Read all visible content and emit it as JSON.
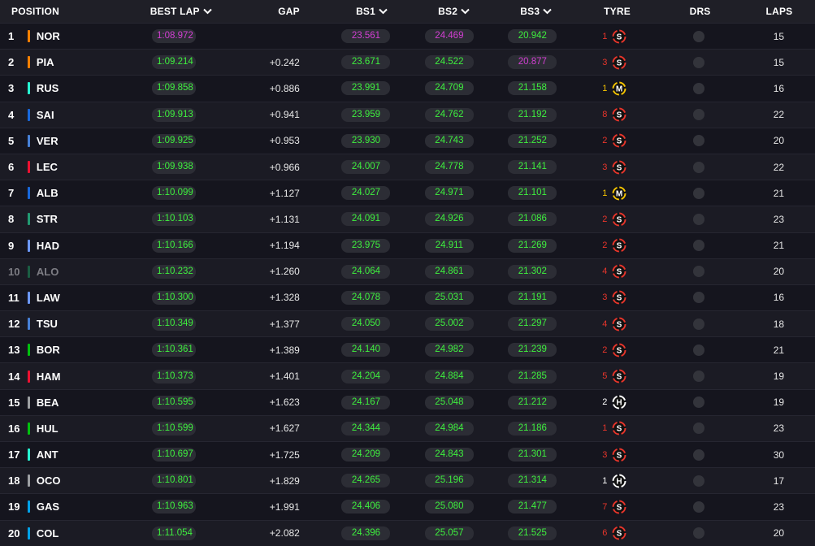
{
  "header": {
    "position": "POSITION",
    "best_lap": "BEST LAP",
    "gap": "GAP",
    "bs1": "BS1",
    "bs2": "BS2",
    "bs3": "BS3",
    "tyre": "TYRE",
    "drs": "DRS",
    "laps": "LAPS"
  },
  "colors": {
    "green": "#3ef03e",
    "purple": "#d33fd3",
    "soft": "#e8352b",
    "medium": "#f6c400",
    "hard": "#ffffff"
  },
  "rows": [
    {
      "pos": "1",
      "code": "NOR",
      "team_color": "#ff8000",
      "best": "1:08.972",
      "best_c": "purple",
      "gap": "",
      "bs1": "23.561",
      "bs1_c": "purple",
      "bs2": "24.469",
      "bs2_c": "purple",
      "bs3": "20.942",
      "bs3_c": "green",
      "tyre_age": "1",
      "compound": "S",
      "laps": "15",
      "dim": false
    },
    {
      "pos": "2",
      "code": "PIA",
      "team_color": "#ff8000",
      "best": "1:09.214",
      "best_c": "green",
      "gap": "+0.242",
      "bs1": "23.671",
      "bs1_c": "green",
      "bs2": "24.522",
      "bs2_c": "green",
      "bs3": "20.877",
      "bs3_c": "purple",
      "tyre_age": "3",
      "compound": "S",
      "laps": "15",
      "dim": false
    },
    {
      "pos": "3",
      "code": "RUS",
      "team_color": "#27f4d2",
      "best": "1:09.858",
      "best_c": "green",
      "gap": "+0.886",
      "bs1": "23.991",
      "bs1_c": "green",
      "bs2": "24.709",
      "bs2_c": "green",
      "bs3": "21.158",
      "bs3_c": "green",
      "tyre_age": "1",
      "compound": "M",
      "laps": "16",
      "dim": false
    },
    {
      "pos": "4",
      "code": "SAI",
      "team_color": "#1868db",
      "best": "1:09.913",
      "best_c": "green",
      "gap": "+0.941",
      "bs1": "23.959",
      "bs1_c": "green",
      "bs2": "24.762",
      "bs2_c": "green",
      "bs3": "21.192",
      "bs3_c": "green",
      "tyre_age": "8",
      "compound": "S",
      "laps": "22",
      "dim": false
    },
    {
      "pos": "5",
      "code": "VER",
      "team_color": "#4781d7",
      "best": "1:09.925",
      "best_c": "green",
      "gap": "+0.953",
      "bs1": "23.930",
      "bs1_c": "green",
      "bs2": "24.743",
      "bs2_c": "green",
      "bs3": "21.252",
      "bs3_c": "green",
      "tyre_age": "2",
      "compound": "S",
      "laps": "20",
      "dim": false
    },
    {
      "pos": "6",
      "code": "LEC",
      "team_color": "#ed1131",
      "best": "1:09.938",
      "best_c": "green",
      "gap": "+0.966",
      "bs1": "24.007",
      "bs1_c": "green",
      "bs2": "24.778",
      "bs2_c": "green",
      "bs3": "21.141",
      "bs3_c": "green",
      "tyre_age": "3",
      "compound": "S",
      "laps": "22",
      "dim": false
    },
    {
      "pos": "7",
      "code": "ALB",
      "team_color": "#1868db",
      "best": "1:10.099",
      "best_c": "green",
      "gap": "+1.127",
      "bs1": "24.027",
      "bs1_c": "green",
      "bs2": "24.971",
      "bs2_c": "green",
      "bs3": "21.101",
      "bs3_c": "green",
      "tyre_age": "1",
      "compound": "M",
      "laps": "21",
      "dim": false
    },
    {
      "pos": "8",
      "code": "STR",
      "team_color": "#229971",
      "best": "1:10.103",
      "best_c": "green",
      "gap": "+1.131",
      "bs1": "24.091",
      "bs1_c": "green",
      "bs2": "24.926",
      "bs2_c": "green",
      "bs3": "21.086",
      "bs3_c": "green",
      "tyre_age": "2",
      "compound": "S",
      "laps": "23",
      "dim": false
    },
    {
      "pos": "9",
      "code": "HAD",
      "team_color": "#6c98ff",
      "best": "1:10.166",
      "best_c": "green",
      "gap": "+1.194",
      "bs1": "23.975",
      "bs1_c": "green",
      "bs2": "24.911",
      "bs2_c": "green",
      "bs3": "21.269",
      "bs3_c": "green",
      "tyre_age": "2",
      "compound": "S",
      "laps": "21",
      "dim": false
    },
    {
      "pos": "10",
      "code": "ALO",
      "team_color": "#1b5e43",
      "best": "1:10.232",
      "best_c": "green",
      "gap": "+1.260",
      "bs1": "24.064",
      "bs1_c": "green",
      "bs2": "24.861",
      "bs2_c": "green",
      "bs3": "21.302",
      "bs3_c": "green",
      "tyre_age": "4",
      "compound": "S",
      "laps": "20",
      "dim": true
    },
    {
      "pos": "11",
      "code": "LAW",
      "team_color": "#6c98ff",
      "best": "1:10.300",
      "best_c": "green",
      "gap": "+1.328",
      "bs1": "24.078",
      "bs1_c": "green",
      "bs2": "25.031",
      "bs2_c": "green",
      "bs3": "21.191",
      "bs3_c": "green",
      "tyre_age": "3",
      "compound": "S",
      "laps": "16",
      "dim": false
    },
    {
      "pos": "12",
      "code": "TSU",
      "team_color": "#4781d7",
      "best": "1:10.349",
      "best_c": "green",
      "gap": "+1.377",
      "bs1": "24.050",
      "bs1_c": "green",
      "bs2": "25.002",
      "bs2_c": "green",
      "bs3": "21.297",
      "bs3_c": "green",
      "tyre_age": "4",
      "compound": "S",
      "laps": "18",
      "dim": false
    },
    {
      "pos": "13",
      "code": "BOR",
      "team_color": "#01c00e",
      "best": "1:10.361",
      "best_c": "green",
      "gap": "+1.389",
      "bs1": "24.140",
      "bs1_c": "green",
      "bs2": "24.982",
      "bs2_c": "green",
      "bs3": "21.239",
      "bs3_c": "green",
      "tyre_age": "2",
      "compound": "S",
      "laps": "21",
      "dim": false
    },
    {
      "pos": "14",
      "code": "HAM",
      "team_color": "#ed1131",
      "best": "1:10.373",
      "best_c": "green",
      "gap": "+1.401",
      "bs1": "24.204",
      "bs1_c": "green",
      "bs2": "24.884",
      "bs2_c": "green",
      "bs3": "21.285",
      "bs3_c": "green",
      "tyre_age": "5",
      "compound": "S",
      "laps": "19",
      "dim": false
    },
    {
      "pos": "15",
      "code": "BEA",
      "team_color": "#9c9fa2",
      "best": "1:10.595",
      "best_c": "green",
      "gap": "+1.623",
      "bs1": "24.167",
      "bs1_c": "green",
      "bs2": "25.048",
      "bs2_c": "green",
      "bs3": "21.212",
      "bs3_c": "green",
      "tyre_age": "2",
      "compound": "H",
      "laps": "19",
      "dim": false
    },
    {
      "pos": "16",
      "code": "HUL",
      "team_color": "#01c00e",
      "best": "1:10.599",
      "best_c": "green",
      "gap": "+1.627",
      "bs1": "24.344",
      "bs1_c": "green",
      "bs2": "24.984",
      "bs2_c": "green",
      "bs3": "21.186",
      "bs3_c": "green",
      "tyre_age": "1",
      "compound": "S",
      "laps": "23",
      "dim": false
    },
    {
      "pos": "17",
      "code": "ANT",
      "team_color": "#27f4d2",
      "best": "1:10.697",
      "best_c": "green",
      "gap": "+1.725",
      "bs1": "24.209",
      "bs1_c": "green",
      "bs2": "24.843",
      "bs2_c": "green",
      "bs3": "21.301",
      "bs3_c": "green",
      "tyre_age": "3",
      "compound": "S",
      "laps": "30",
      "dim": false
    },
    {
      "pos": "18",
      "code": "OCO",
      "team_color": "#9c9fa2",
      "best": "1:10.801",
      "best_c": "green",
      "gap": "+1.829",
      "bs1": "24.265",
      "bs1_c": "green",
      "bs2": "25.196",
      "bs2_c": "green",
      "bs3": "21.314",
      "bs3_c": "green",
      "tyre_age": "1",
      "compound": "H",
      "laps": "17",
      "dim": false
    },
    {
      "pos": "19",
      "code": "GAS",
      "team_color": "#00a1e8",
      "best": "1:10.963",
      "best_c": "green",
      "gap": "+1.991",
      "bs1": "24.406",
      "bs1_c": "green",
      "bs2": "25.080",
      "bs2_c": "green",
      "bs3": "21.477",
      "bs3_c": "green",
      "tyre_age": "7",
      "compound": "S",
      "laps": "23",
      "dim": false
    },
    {
      "pos": "20",
      "code": "COL",
      "team_color": "#00a1e8",
      "best": "1:11.054",
      "best_c": "green",
      "gap": "+2.082",
      "bs1": "24.396",
      "bs1_c": "green",
      "bs2": "25.057",
      "bs2_c": "green",
      "bs3": "21.525",
      "bs3_c": "green",
      "tyre_age": "6",
      "compound": "S",
      "laps": "20",
      "dim": false
    }
  ]
}
